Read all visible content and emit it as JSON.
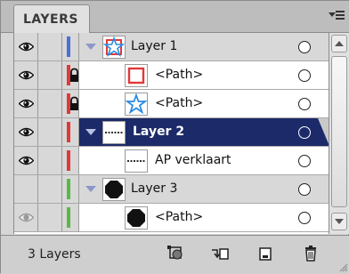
{
  "panel": {
    "tab_label": "LAYERS",
    "menu_icon": "panel-menu-icon"
  },
  "layers": [
    {
      "row": "layer",
      "visible": true,
      "locked": false,
      "color": "#4a6fd6",
      "name": "Layer 1",
      "expanded": true,
      "thumb": "shapes-thumb-icon",
      "selected": false
    },
    {
      "row": "sub",
      "visible": true,
      "locked": true,
      "color": "#e0393a",
      "name": "<Path>",
      "thumb": "red-rectangle-thumb-icon",
      "selected": false
    },
    {
      "row": "sub",
      "visible": true,
      "locked": true,
      "color": "#e0393a",
      "name": "<Path>",
      "thumb": "blue-star-thumb-icon",
      "selected": false
    },
    {
      "row": "layer",
      "visible": true,
      "locked": false,
      "color": "#e0393a",
      "name": "Layer 2",
      "expanded": true,
      "thumb": "dashed-line-thumb-icon",
      "selected": true
    },
    {
      "row": "sub",
      "visible": true,
      "locked": false,
      "color": "#e0393a",
      "name": "AP verklaart",
      "thumb": "dashed-line-thumb-icon",
      "selected": false
    },
    {
      "row": "layer",
      "visible": false,
      "locked": false,
      "color": "#58b947",
      "name": "Layer 3",
      "expanded": true,
      "thumb": "black-octagon-thumb-icon",
      "selected": false
    },
    {
      "row": "sub",
      "visible": true,
      "locked": false,
      "color": "#58b947",
      "name": "<Path>",
      "thumb": "black-octagon-thumb-icon",
      "selected": false,
      "dim_eye": true
    }
  ],
  "footer": {
    "count_label": "3 Layers",
    "buttons": [
      "make-clipping-mask-icon",
      "create-new-sublayer-icon",
      "create-new-layer-icon",
      "delete-layer-icon"
    ]
  }
}
